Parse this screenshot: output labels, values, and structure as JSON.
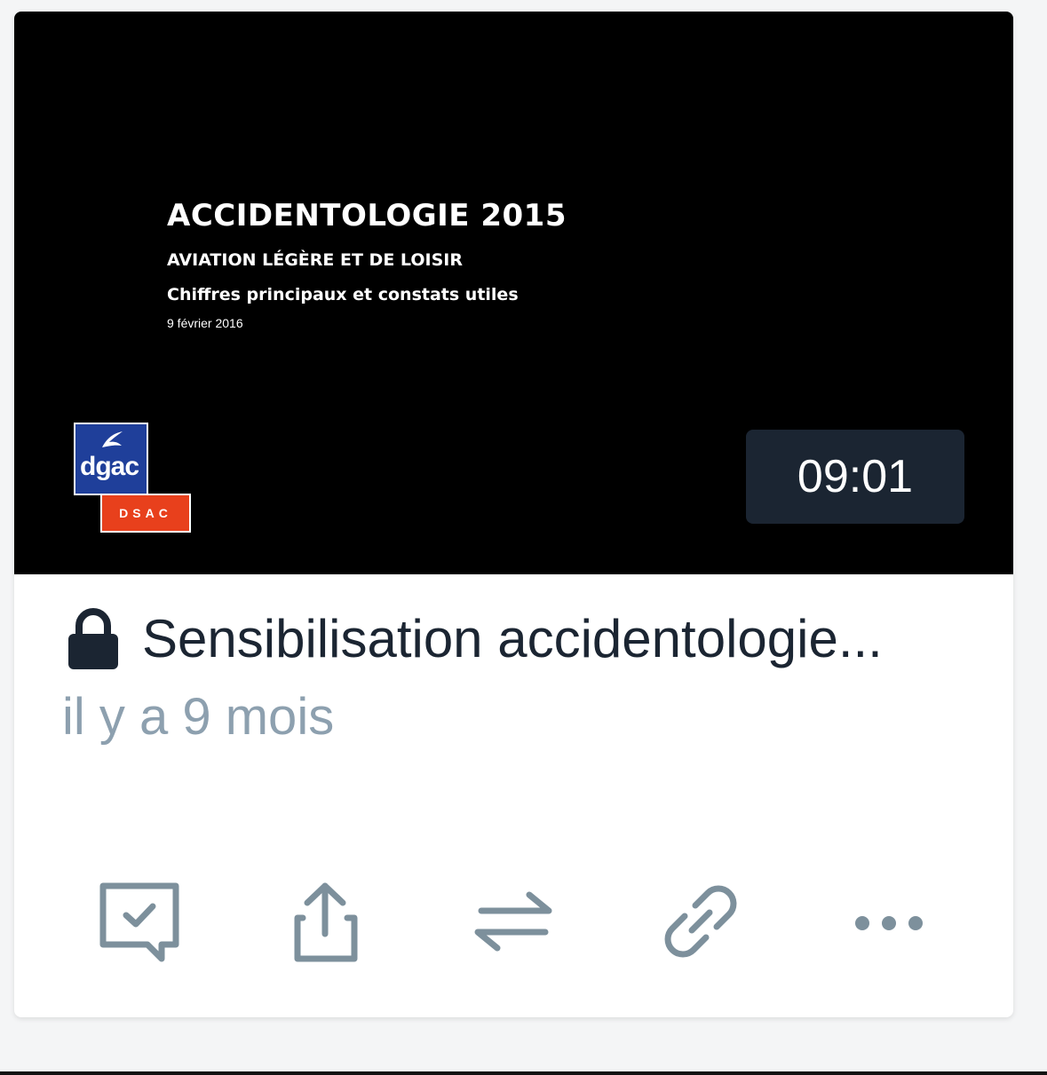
{
  "thumbnail": {
    "slide_title": "ACCIDENTOLOGIE 2015",
    "slide_subtitle": "AVIATION LÉGÈRE ET DE LOISIR",
    "slide_line": "Chiffres principaux et constats utiles",
    "slide_date": "9 février 2016",
    "logo_text": "dgac",
    "logo_sub": "DSAC",
    "duration": "09:01"
  },
  "video": {
    "title": "Sensibilisation accidentologie...",
    "time_ago": "il y a 9 mois",
    "lock_icon": "lock-icon"
  },
  "actions": [
    {
      "icon": "comment-check-icon"
    },
    {
      "icon": "share-icon"
    },
    {
      "icon": "transfer-icon"
    },
    {
      "icon": "link-icon"
    },
    {
      "icon": "more-icon"
    }
  ],
  "colors": {
    "card_bg": "#ffffff",
    "thumbnail_bg": "#000000",
    "duration_bg": "#1b2532",
    "title_text": "#1b2532",
    "muted_text": "#8da0af",
    "icon_color": "#7d909c",
    "logo_blue": "#1f3f9a",
    "logo_red": "#e8401c"
  }
}
